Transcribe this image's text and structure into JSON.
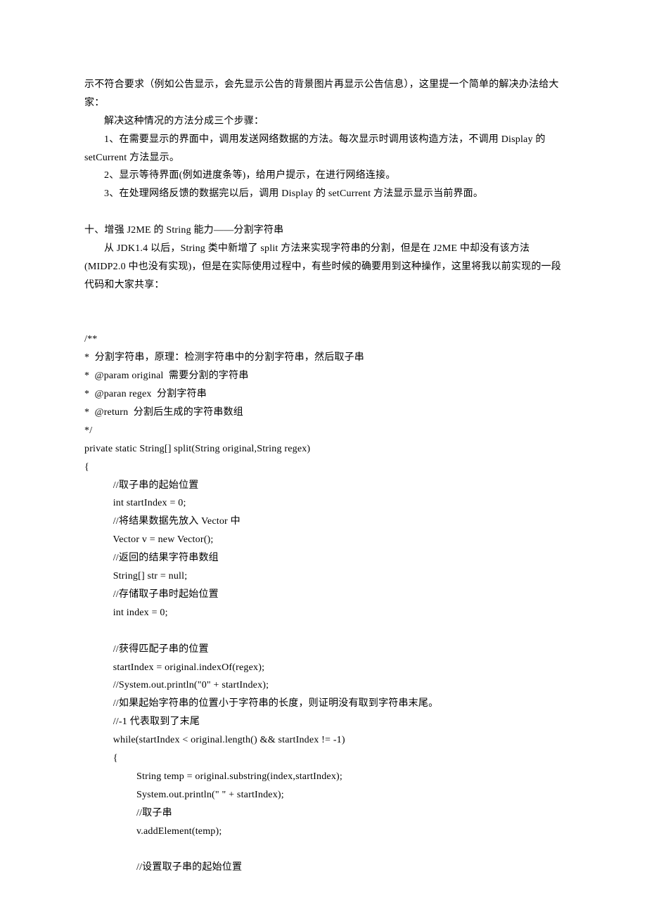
{
  "top": {
    "p1": "示不符合要求（例如公告显示，会先显示公告的背景图片再显示公告信息），这里提一个简单的解决办法给大家：",
    "p2": "解决这种情况的方法分成三个步骤：",
    "p3": "1、在需要显示的界面中，调用发送网络数据的方法。每次显示时调用该构造方法，不调用 Display 的 setCurrent 方法显示。",
    "p4": "2、显示等待界面(例如进度条等)，给用户提示，在进行网络连接。",
    "p5": "3、在处理网络反馈的数据完以后，调用 Display 的 setCurrent 方法显示显示当前界面。"
  },
  "section10": {
    "title": "十、增强 J2ME 的 String 能力——分割字符串",
    "body": "从 JDK1.4 以后，String 类中新增了 split 方法来实现字符串的分割，但是在 J2ME 中却没有该方法(MIDP2.0 中也没有实现)，但是在实际使用过程中，有些时候的确要用到这种操作，这里将我以前实现的一段代码和大家共享："
  },
  "code": {
    "c1": "/**",
    "c2": "*  分割字符串，原理：检测字符串中的分割字符串，然后取子串",
    "c3": "*  @param original  需要分割的字符串",
    "c4": "*  @paran regex  分割字符串",
    "c5": "*  @return  分割后生成的字符串数组",
    "c6": "*/",
    "c7": "private static String[] split(String original,String regex)",
    "c8": "{",
    "c9": "           //取子串的起始位置",
    "c10": "           int startIndex = 0;",
    "c11": "           //将结果数据先放入 Vector 中",
    "c12": "           Vector v = new Vector();",
    "c13": "           //返回的结果字符串数组",
    "c14": "           String[] str = null;",
    "c15": "           //存储取子串时起始位置",
    "c16": "           int index = 0;",
    "c17": "           //获得匹配子串的位置",
    "c18": "           startIndex = original.indexOf(regex);",
    "c19": "           //System.out.println(\"0\" + startIndex);",
    "c20": "           //如果起始字符串的位置小于字符串的长度，则证明没有取到字符串末尾。",
    "c21": "           //-1 代表取到了末尾",
    "c22": "           while(startIndex < original.length() && startIndex != -1)",
    "c23": "           {",
    "c24": "                    String temp = original.substring(index,startIndex);",
    "c25": "                    System.out.println(\" \" + startIndex);",
    "c26": "                    //取子串",
    "c27": "                    v.addElement(temp);",
    "c28": "                    //设置取子串的起始位置"
  }
}
